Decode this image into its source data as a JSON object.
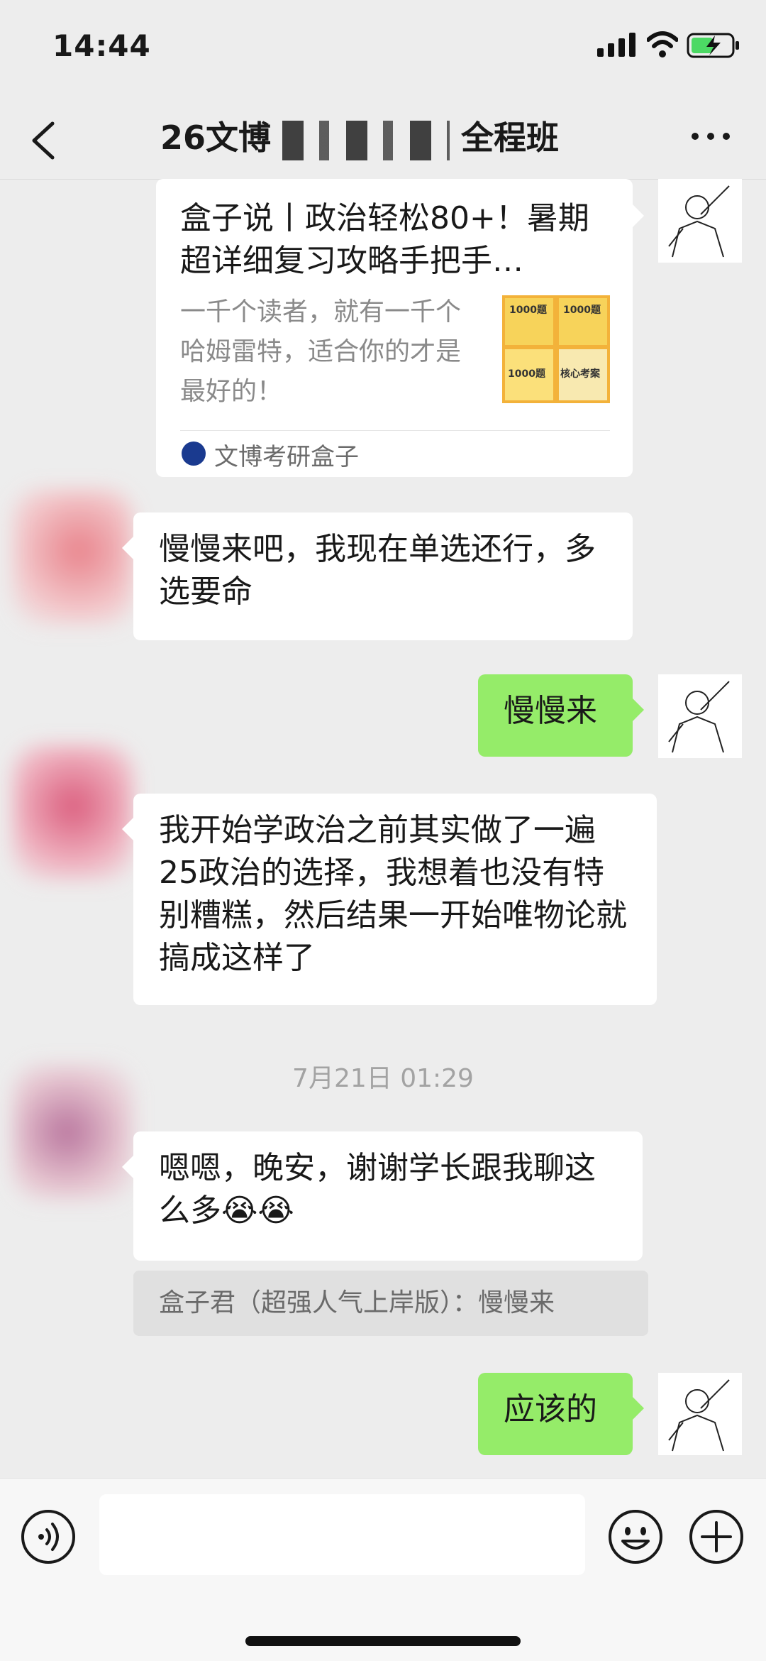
{
  "status": {
    "time": "14:44"
  },
  "nav": {
    "title_left": "26文博",
    "title_right": "全程班"
  },
  "card": {
    "title": "盒子说丨政治轻松80+！暑期超详细复习攻略手把手…",
    "description": "一千个读者，就有一千个哈姆雷特，适合你的才是最好的！",
    "source": "文博考研盒子",
    "thumb_labels": [
      "1000题",
      "1000题",
      "1000题",
      "核心考案"
    ]
  },
  "messages": [
    {
      "from": "other",
      "text": "慢慢来吧，我现在单选还行，多选要命"
    },
    {
      "from": "me",
      "text": "慢慢来"
    },
    {
      "from": "other",
      "text": "我开始学政治之前其实做了一遍25政治的选择，我想着也没有特别糟糕，然后结果一开始唯物论就搞成这样了"
    },
    {
      "from": "other",
      "text": "嗯嗯，晚安，谢谢学长跟我聊这么多😭😭"
    },
    {
      "from": "me",
      "text": "应该的"
    }
  ],
  "time_separator": "7月21日 01:29",
  "quote": "盒子君（超强人气上岸版）：慢慢来",
  "colors": {
    "bg": "#ededed",
    "green_bubble": "#95ec69",
    "white_bubble": "#ffffff"
  },
  "icons": [
    "back-chevron-icon",
    "more-dots-icon",
    "voice-icon",
    "emoji-icon",
    "plus-icon",
    "signal-icon",
    "wifi-icon",
    "battery-charging-icon"
  ]
}
